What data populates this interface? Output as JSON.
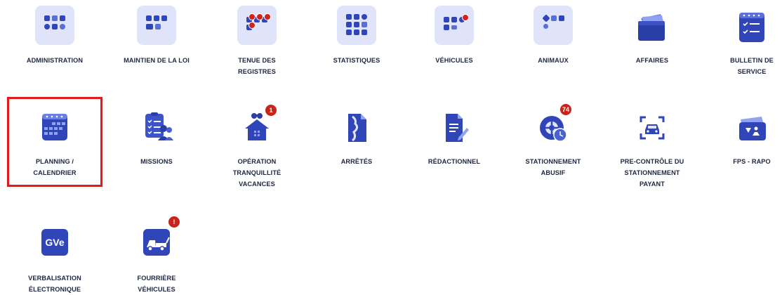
{
  "tiles": {
    "administration": {
      "label": [
        "ADMINISTRATION"
      ]
    },
    "maintien": {
      "label": [
        "MAINTIEN DE LA LOI"
      ]
    },
    "registres": {
      "label": [
        "TENUE DES",
        "REGISTRES"
      ]
    },
    "statistiques": {
      "label": [
        "STATISTIQUES"
      ]
    },
    "vehicules": {
      "label": [
        "VÉHICULES"
      ]
    },
    "animaux": {
      "label": [
        "ANIMAUX"
      ]
    },
    "affaires": {
      "label": [
        "AFFAIRES"
      ]
    },
    "bulletin": {
      "label": [
        "BULLETIN DE",
        "SERVICE"
      ]
    },
    "planning": {
      "label": [
        "PLANNING /",
        "CALENDRIER"
      ]
    },
    "missions": {
      "label": [
        "MISSIONS"
      ]
    },
    "otv": {
      "label": [
        "OPÉRATION",
        "TRANQUILLITÉ",
        "VACANCES"
      ],
      "badge": "1"
    },
    "arretes": {
      "label": [
        "ARRÊTÉS"
      ]
    },
    "redactionnel": {
      "label": [
        "RÉDACTIONNEL"
      ]
    },
    "stationnement": {
      "label": [
        "STATIONNEMENT",
        "ABUSIF"
      ],
      "badge": "74"
    },
    "precontrole": {
      "label": [
        "PRE-CONTRÔLE DU",
        "STATIONNEMENT",
        "PAYANT"
      ]
    },
    "fps": {
      "label": [
        "FPS - RAPO"
      ]
    },
    "verbalisation": {
      "label": [
        "VERBALISATION",
        "ÉLECTRONIQUE"
      ],
      "icon_text": "GVe"
    },
    "fourriere": {
      "label": [
        "FOURRIÈRE",
        "VÉHICULES"
      ],
      "badge": "!"
    }
  },
  "colors": {
    "icon_bg": "#dfe4fb",
    "icon_blue": "#3046b8",
    "badge_red": "#c9241b",
    "highlight": "#e11b1b"
  }
}
